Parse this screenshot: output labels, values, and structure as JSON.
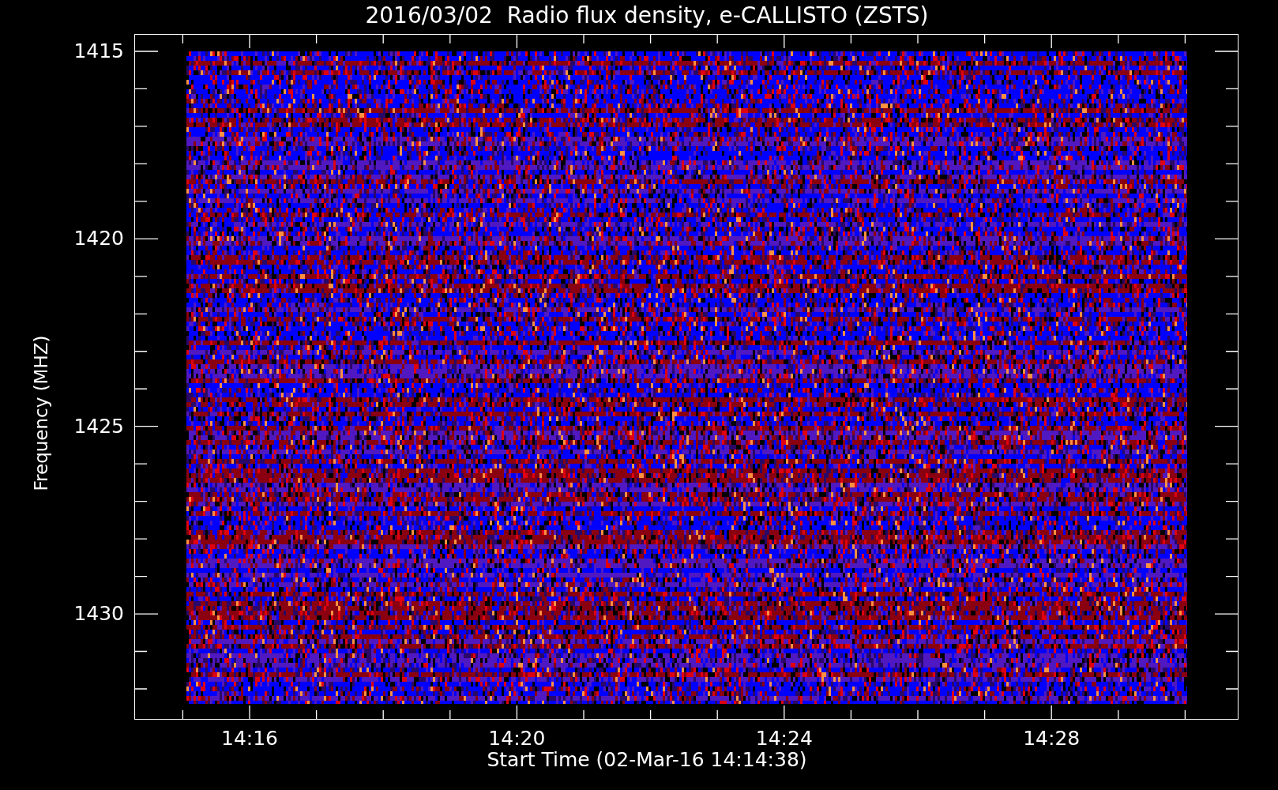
{
  "title": "2016/03/02  Radio flux density, e-CALLISTO (ZSTS)",
  "y_axis": {
    "label": "Frequency (MHZ)",
    "ticks": [
      "1415",
      "1420",
      "1425",
      "1430"
    ]
  },
  "x_axis": {
    "label": "Start Time (02-Mar-16 14:14:38)",
    "ticks": [
      "14:16",
      "14:20",
      "14:24",
      "14:28"
    ]
  }
}
